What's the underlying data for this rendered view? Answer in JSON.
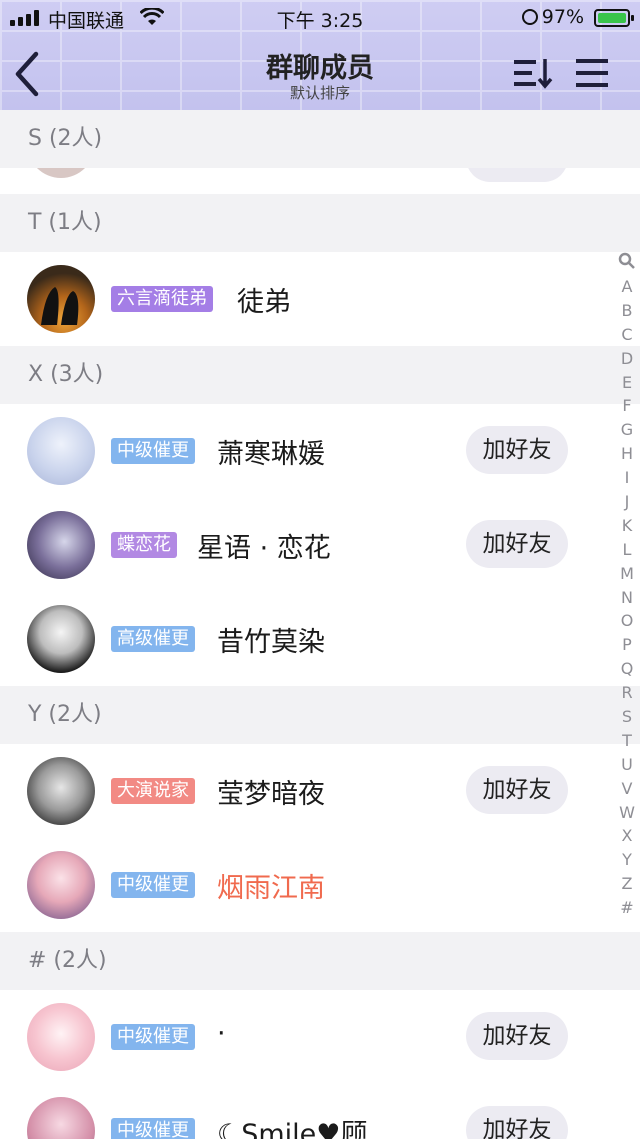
{
  "status_bar": {
    "carrier": "中国联通",
    "time": "下午 3:25",
    "battery": "97%"
  },
  "nav": {
    "title": "群聊成员",
    "subtitle": "默认排序"
  },
  "sections": [
    {
      "header": "S (2人)"
    },
    {
      "header": "T (1人)"
    },
    {
      "header": "X (3人)"
    },
    {
      "header": "Y (2人)"
    },
    {
      "header": "# (2人)"
    }
  ],
  "members": [
    {
      "badge": "六言滴徒弟",
      "badge_color": "#a47ee6",
      "name": "徒弟",
      "name_color": "#1b1b1b",
      "button": ""
    },
    {
      "badge": "中级催更",
      "badge_color": "#83b5ee",
      "name": "萧寒琳媛",
      "name_color": "#1b1b1b",
      "button": "加好友"
    },
    {
      "badge": "蝶恋花",
      "badge_color": "#b289e3",
      "name": "星语 · 恋花",
      "name_color": "#1b1b1b",
      "button": "加好友"
    },
    {
      "badge": "高级催更",
      "badge_color": "#83b5ee",
      "name": "昔竹莫染",
      "name_color": "#1b1b1b",
      "button": ""
    },
    {
      "badge": "大演说家",
      "badge_color": "#f28a84",
      "name": "莹梦暗夜",
      "name_color": "#1b1b1b",
      "button": "加好友"
    },
    {
      "badge": "中级催更",
      "badge_color": "#83b5ee",
      "name": "烟雨江南",
      "name_color": "#f06a4e",
      "button": ""
    },
    {
      "badge": "中级催更",
      "badge_color": "#83b5ee",
      "name": "·",
      "name_color": "#1b1b1b",
      "button": "加好友"
    },
    {
      "badge": "中级催更",
      "badge_color": "#83b5ee",
      "name": "☾Smile♥顾…",
      "name_color": "#1b1b1b",
      "button": "加好友"
    }
  ],
  "index_letters": [
    "A",
    "B",
    "C",
    "D",
    "E",
    "F",
    "G",
    "H",
    "I",
    "J",
    "K",
    "L",
    "M",
    "N",
    "O",
    "P",
    "Q",
    "R",
    "S",
    "T",
    "U",
    "V",
    "W",
    "X",
    "Y",
    "Z",
    "#"
  ]
}
